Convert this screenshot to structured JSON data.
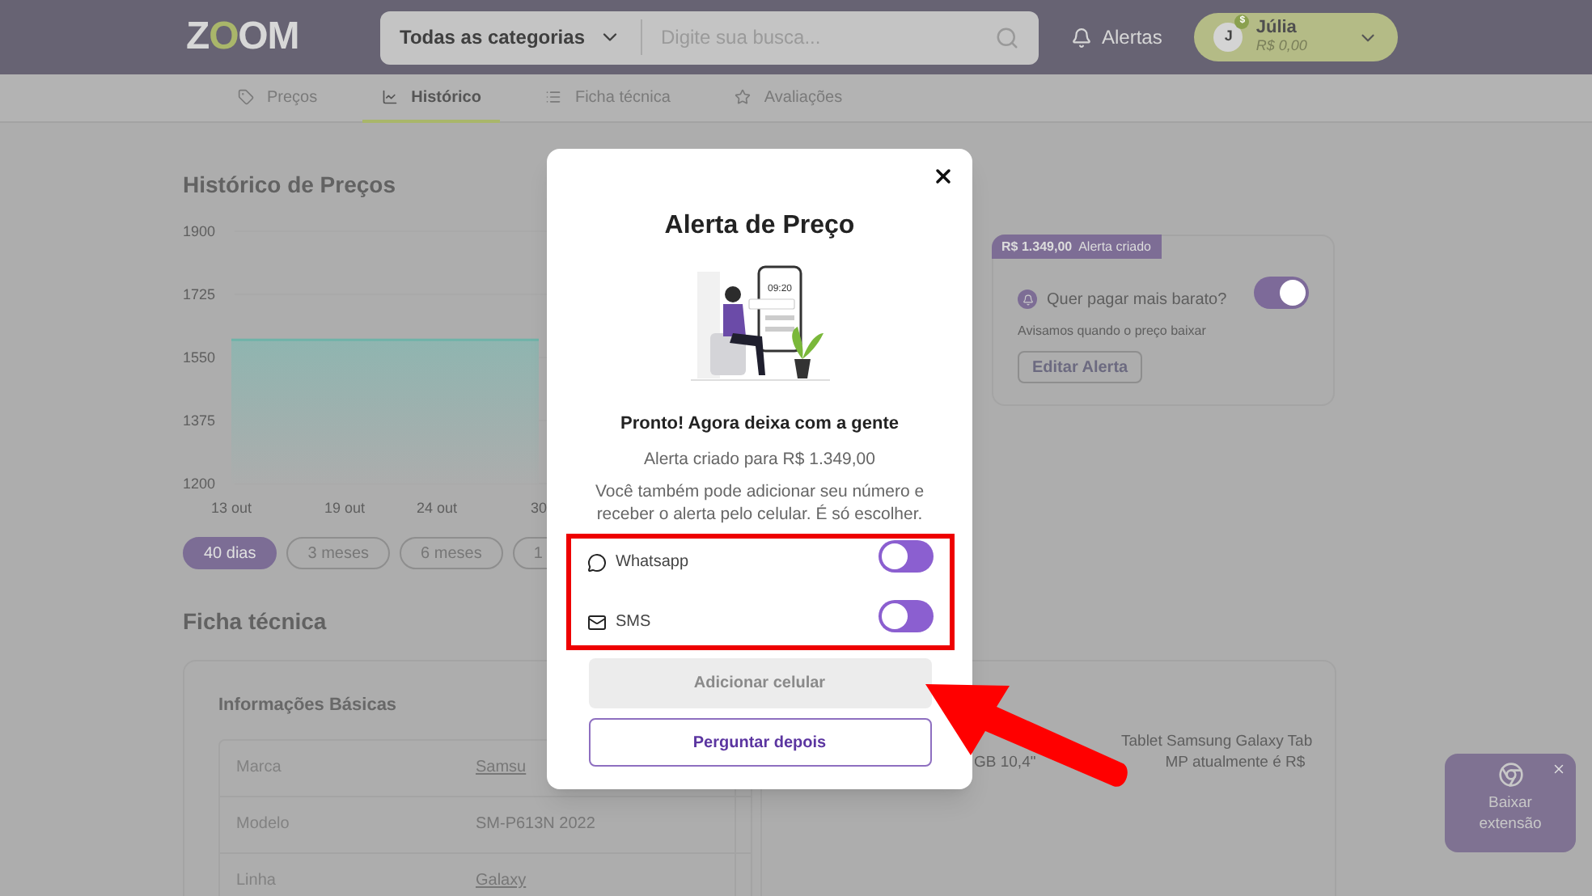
{
  "header": {
    "logo": "ZOOM",
    "category": "Todas as categorias",
    "search_placeholder": "Digite sua busca...",
    "alerts": "Alertas",
    "user": {
      "initial": "J",
      "badge": "$",
      "name": "Júlia",
      "balance": "R$ 0,00"
    }
  },
  "tabs": [
    {
      "label": "Preços",
      "selected": false
    },
    {
      "label": "Histórico",
      "selected": true
    },
    {
      "label": "Ficha técnica",
      "selected": false
    },
    {
      "label": "Avaliações",
      "selected": false
    }
  ],
  "history": {
    "title": "Histórico de Preços",
    "chart_data": {
      "type": "area",
      "x": [
        "13 out",
        "19 out",
        "24 out",
        "30"
      ],
      "series": [
        {
          "color": "#6fb3a8",
          "values": [
            1599,
            1599,
            1599,
            1599
          ]
        }
      ],
      "ylim": [
        1200,
        1900
      ],
      "yticks": [
        1200,
        1375,
        1550,
        1725,
        1900
      ]
    },
    "periods": [
      {
        "label": "40 dias",
        "selected": true
      },
      {
        "label": "3 meses",
        "selected": false
      },
      {
        "label": "6 meses",
        "selected": false
      },
      {
        "label": "1",
        "selected": false
      }
    ]
  },
  "alert_card": {
    "price": "R$ 1.349,00",
    "status": "Alerta criado",
    "question": "Quer pagar mais barato?",
    "on": true,
    "hint": "Avisamos quando o preço baixar",
    "button": "Editar Alerta"
  },
  "specs": {
    "title": "Ficha técnica",
    "section": "Informações Básicas",
    "rows": [
      {
        "label": "Marca",
        "value": "Samsu",
        "link": true
      },
      {
        "label": "Modelo",
        "value": "SM-P613N 2022",
        "link": false
      },
      {
        "label": "Linha",
        "value": "Galaxy",
        "link": true
      }
    ],
    "description_lines": [
      [
        "Tablet Samsung Galaxy Tab"
      ],
      [
        "GB 10,4\"",
        "MP atualmente é R$"
      ]
    ]
  },
  "extension": {
    "label": "Baixar extensão"
  },
  "modal": {
    "title": "Alerta de Preço",
    "phone_time": "09:20",
    "headline": "Pronto! Agora deixa com a gente",
    "created": "Alerta criado para R$ 1.349,00",
    "text": "Você também pode adicionar seu número e receber o alerta pelo celular. É só escolher.",
    "channels": [
      {
        "kind": "chat",
        "label": "Whatsapp",
        "on": false
      },
      {
        "kind": "mail",
        "label": "SMS",
        "on": false
      }
    ],
    "add_button": {
      "label": "Adicionar celular",
      "disabled": true
    },
    "later_button": "Perguntar depois"
  }
}
